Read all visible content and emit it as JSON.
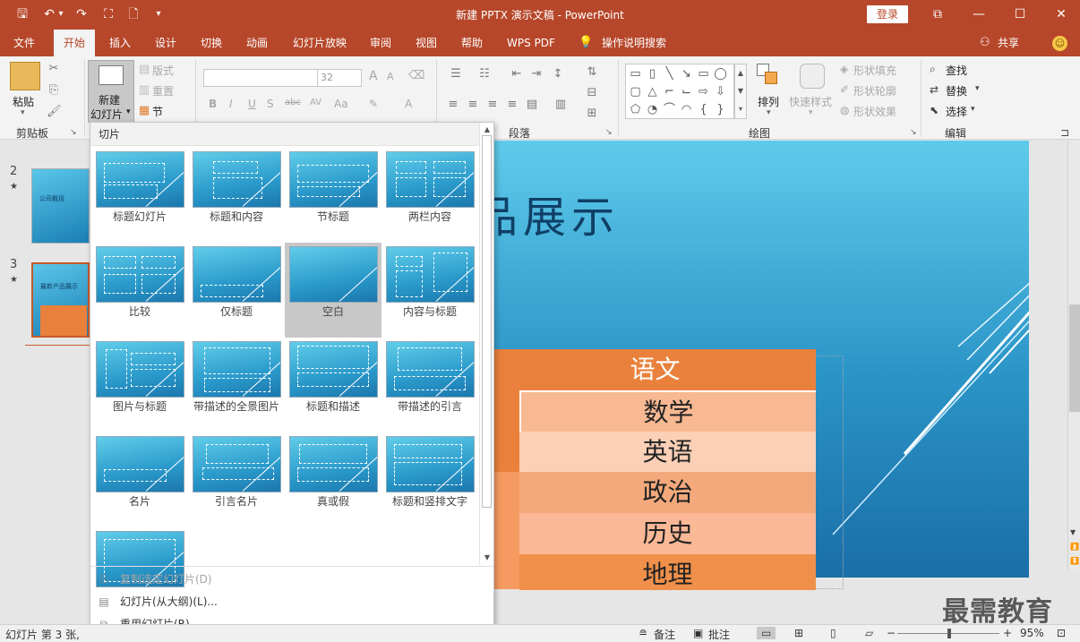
{
  "app": {
    "title": "新建 PPTX 演示文稿 - PowerPoint",
    "login": "登录",
    "win_controls": {
      "ribbon_opts": "⧉",
      "minimize": "—",
      "maximize": "☐",
      "close": "✕"
    },
    "quick_access": {
      "save": "🖫",
      "undo": "↶",
      "undo_more": "▾",
      "redo": "↷",
      "start_from": "⛶",
      "new": "🗋",
      "customize": "▾"
    }
  },
  "tabs": [
    "文件",
    "开始",
    "插入",
    "设计",
    "切换",
    "动画",
    "幻灯片放映",
    "审阅",
    "视图",
    "帮助",
    "WPS PDF"
  ],
  "active_tab": "开始",
  "tell_me": "操作说明搜索",
  "share": "共享",
  "ribbon": {
    "clipboard": {
      "paste": "粘贴",
      "label": "剪贴板"
    },
    "slides": {
      "new_slide_1": "新建",
      "new_slide_2": "幻灯片",
      "layout": "版式",
      "reset": "重置",
      "section": "节"
    },
    "font": {
      "size_value": "32",
      "bold": "B",
      "italic": "I",
      "underline": "U",
      "strike": "S",
      "shadow": "abc",
      "spacing": "AV",
      "case": "Aa",
      "clear": "A",
      "color": "A",
      "grow": "A",
      "shrink": "A"
    },
    "paragraph": {
      "label": "段落"
    },
    "drawing": {
      "arrange": "排列",
      "quick_styles": "快速样式",
      "fill": "形状填充",
      "outline": "形状轮廓",
      "effects": "形状效果",
      "label": "绘图"
    },
    "editing": {
      "find": "查找",
      "replace": "替换",
      "select": "选择",
      "label": "编辑"
    }
  },
  "thumbnails": [
    {
      "number": "2",
      "star": "★",
      "title": "公司概括"
    },
    {
      "number": "3",
      "star": "★",
      "title": "最新产品展示"
    }
  ],
  "slide": {
    "title": "品展示",
    "table_header": "语文",
    "table_rows": [
      "数学",
      "英语",
      "政治",
      "历史",
      "地理"
    ],
    "colors": {
      "header": "#e9813c",
      "row_a": "#f7b892",
      "row_b": "#fbd0b6",
      "row_c": "#f3a97c",
      "row_d": "#fbb896",
      "row_e": "#f0904a"
    }
  },
  "gallery": {
    "header": "切片",
    "layouts": [
      "标题幻灯片",
      "标题和内容",
      "节标题",
      "两栏内容",
      "比较",
      "仅标题",
      "空白",
      "内容与标题",
      "图片与标题",
      "带描述的全景图片",
      "标题和描述",
      "带描述的引言",
      "名片",
      "引言名片",
      "真或假",
      "标题和竖排文字",
      ""
    ],
    "selected": "空白",
    "menu": [
      {
        "label": "复制选定幻灯片(D)",
        "disabled": true
      },
      {
        "label": "幻灯片(从大纲)(L)...",
        "disabled": false
      },
      {
        "label": "重用幻灯片(R)...",
        "disabled": false
      }
    ]
  },
  "status": {
    "slide_info": "幻灯片 第 3 张,",
    "notes": "备注",
    "comments": "批注",
    "zoom": "95%"
  },
  "watermark": "最需教育"
}
